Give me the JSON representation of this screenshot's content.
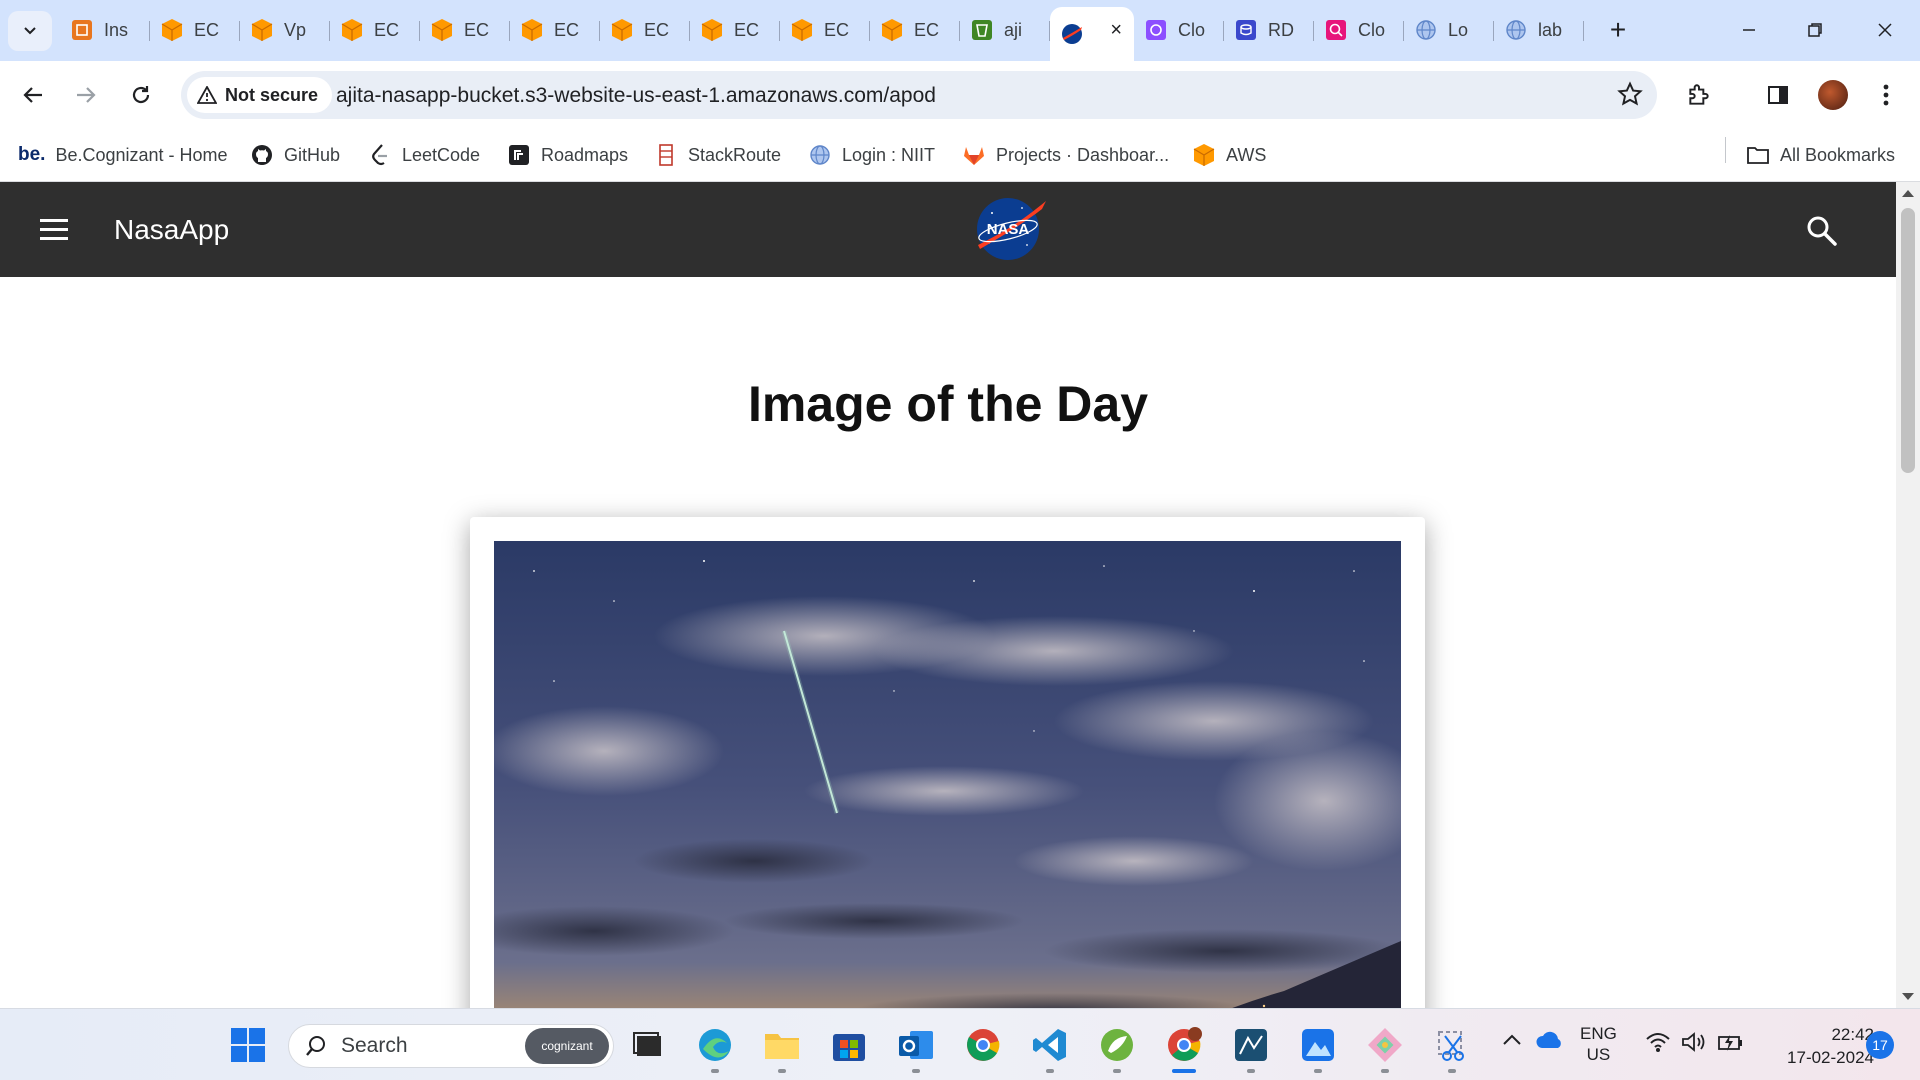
{
  "browser": {
    "tabs": [
      {
        "label": "Ins",
        "icon": "aws-feature-icon"
      },
      {
        "label": "EC",
        "icon": "aws-cube-icon"
      },
      {
        "label": "Vp",
        "icon": "aws-cube-icon"
      },
      {
        "label": "EC",
        "icon": "aws-cube-icon"
      },
      {
        "label": "EC",
        "icon": "aws-cube-icon"
      },
      {
        "label": "EC",
        "icon": "aws-cube-icon"
      },
      {
        "label": "EC",
        "icon": "aws-cube-icon"
      },
      {
        "label": "EC",
        "icon": "aws-cube-icon"
      },
      {
        "label": "EC",
        "icon": "aws-cube-icon"
      },
      {
        "label": "EC",
        "icon": "aws-cube-icon"
      },
      {
        "label": "aji",
        "icon": "s3-bucket-icon"
      }
    ],
    "active_tab": {
      "icon": "nasa-icon",
      "close": "×"
    },
    "tabs_after": [
      {
        "label": "Clo",
        "icon": "cloudfront-icon"
      },
      {
        "label": "RD",
        "icon": "rds-icon"
      },
      {
        "label": "Clo",
        "icon": "cloudwatch-icon"
      },
      {
        "label": "Lo",
        "icon": "globe-icon"
      },
      {
        "label": "lab",
        "icon": "globe-icon"
      }
    ],
    "new_tab": "+",
    "security_label": "Not secure",
    "url": "ajita-nasapp-bucket.s3-website-us-east-1.amazonaws.com/apod",
    "bookmarks": [
      {
        "label": "Be.Cognizant - Home",
        "icon": "be-icon",
        "icon_text": "be."
      },
      {
        "label": "GitHub",
        "icon": "github-icon"
      },
      {
        "label": "LeetCode",
        "icon": "leetcode-icon"
      },
      {
        "label": "Roadmaps",
        "icon": "roadmaps-icon"
      },
      {
        "label": "StackRoute",
        "icon": "stackroute-icon"
      },
      {
        "label": "Login : NIIT",
        "icon": "globe-icon"
      },
      {
        "label": "Projects · Dashboar...",
        "icon": "gitlab-icon"
      },
      {
        "label": "AWS",
        "icon": "aws-cube-icon"
      }
    ],
    "all_bookmarks": "All Bookmarks"
  },
  "app": {
    "title": "NasaApp",
    "logo_text": "NASA",
    "heading": "Image of the Day"
  },
  "taskbar": {
    "search_placeholder": "Search",
    "search_badge": "cognizant",
    "lang_line1": "ENG",
    "lang_line2": "US",
    "time": "22:42",
    "date": "17-02-2024",
    "notification_count": "17"
  },
  "colors": {
    "tabstrip": "#d3e3fd",
    "appbar": "#2f2f2f",
    "aws_orange": "#ff9900",
    "accent": "#1a73e8"
  }
}
